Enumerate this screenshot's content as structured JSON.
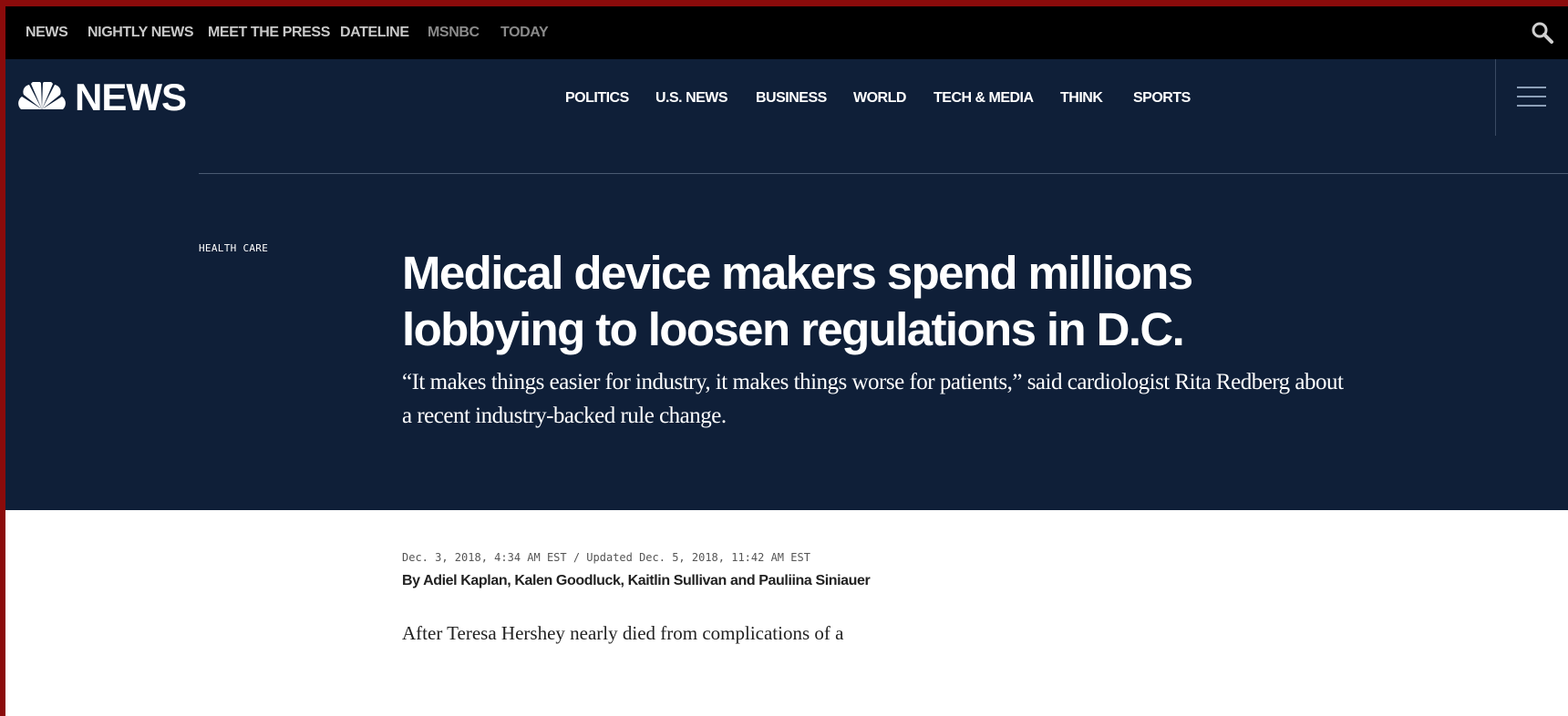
{
  "topbar": {
    "links": [
      "NEWS",
      "NIGHTLY NEWS",
      "MEET THE PRESS",
      "DATELINE",
      "MSNBC",
      "TODAY"
    ],
    "search_icon": "search-icon"
  },
  "navbar": {
    "logo_text": "NEWS",
    "logo_icon": "peacock-icon",
    "items": [
      "POLITICS",
      "U.S. NEWS",
      "BUSINESS",
      "WORLD",
      "TECH & MEDIA",
      "THINK",
      "SPORTS"
    ],
    "menu_icon": "hamburger-menu-icon"
  },
  "article": {
    "section": "HEALTH CARE",
    "headline": "Medical device makers spend millions lobbying to loosen regulations in D.C.",
    "dek": "“It makes things easier for industry, it makes things worse for patients,” said cardiologist Rita Redberg about a recent industry-backed rule change.",
    "dateline": "Dec. 3, 2018, 4:34 AM EST / Updated Dec. 5, 2018, 11:42 AM EST",
    "byline_prefix": "By ",
    "authors": [
      "Adiel Kaplan",
      "Kalen Goodluck",
      "Kaitlin Sullivan",
      "Pauliina Siniauer"
    ],
    "byline_sep1": ", ",
    "byline_sep2": ", ",
    "byline_sep3": " and ",
    "body_first_line": "After Teresa Hershey nearly died from complications of a"
  },
  "colors": {
    "topbar_bg": "#000000",
    "nav_bg": "#0f1f38",
    "page_border": "#8b0b0b"
  }
}
